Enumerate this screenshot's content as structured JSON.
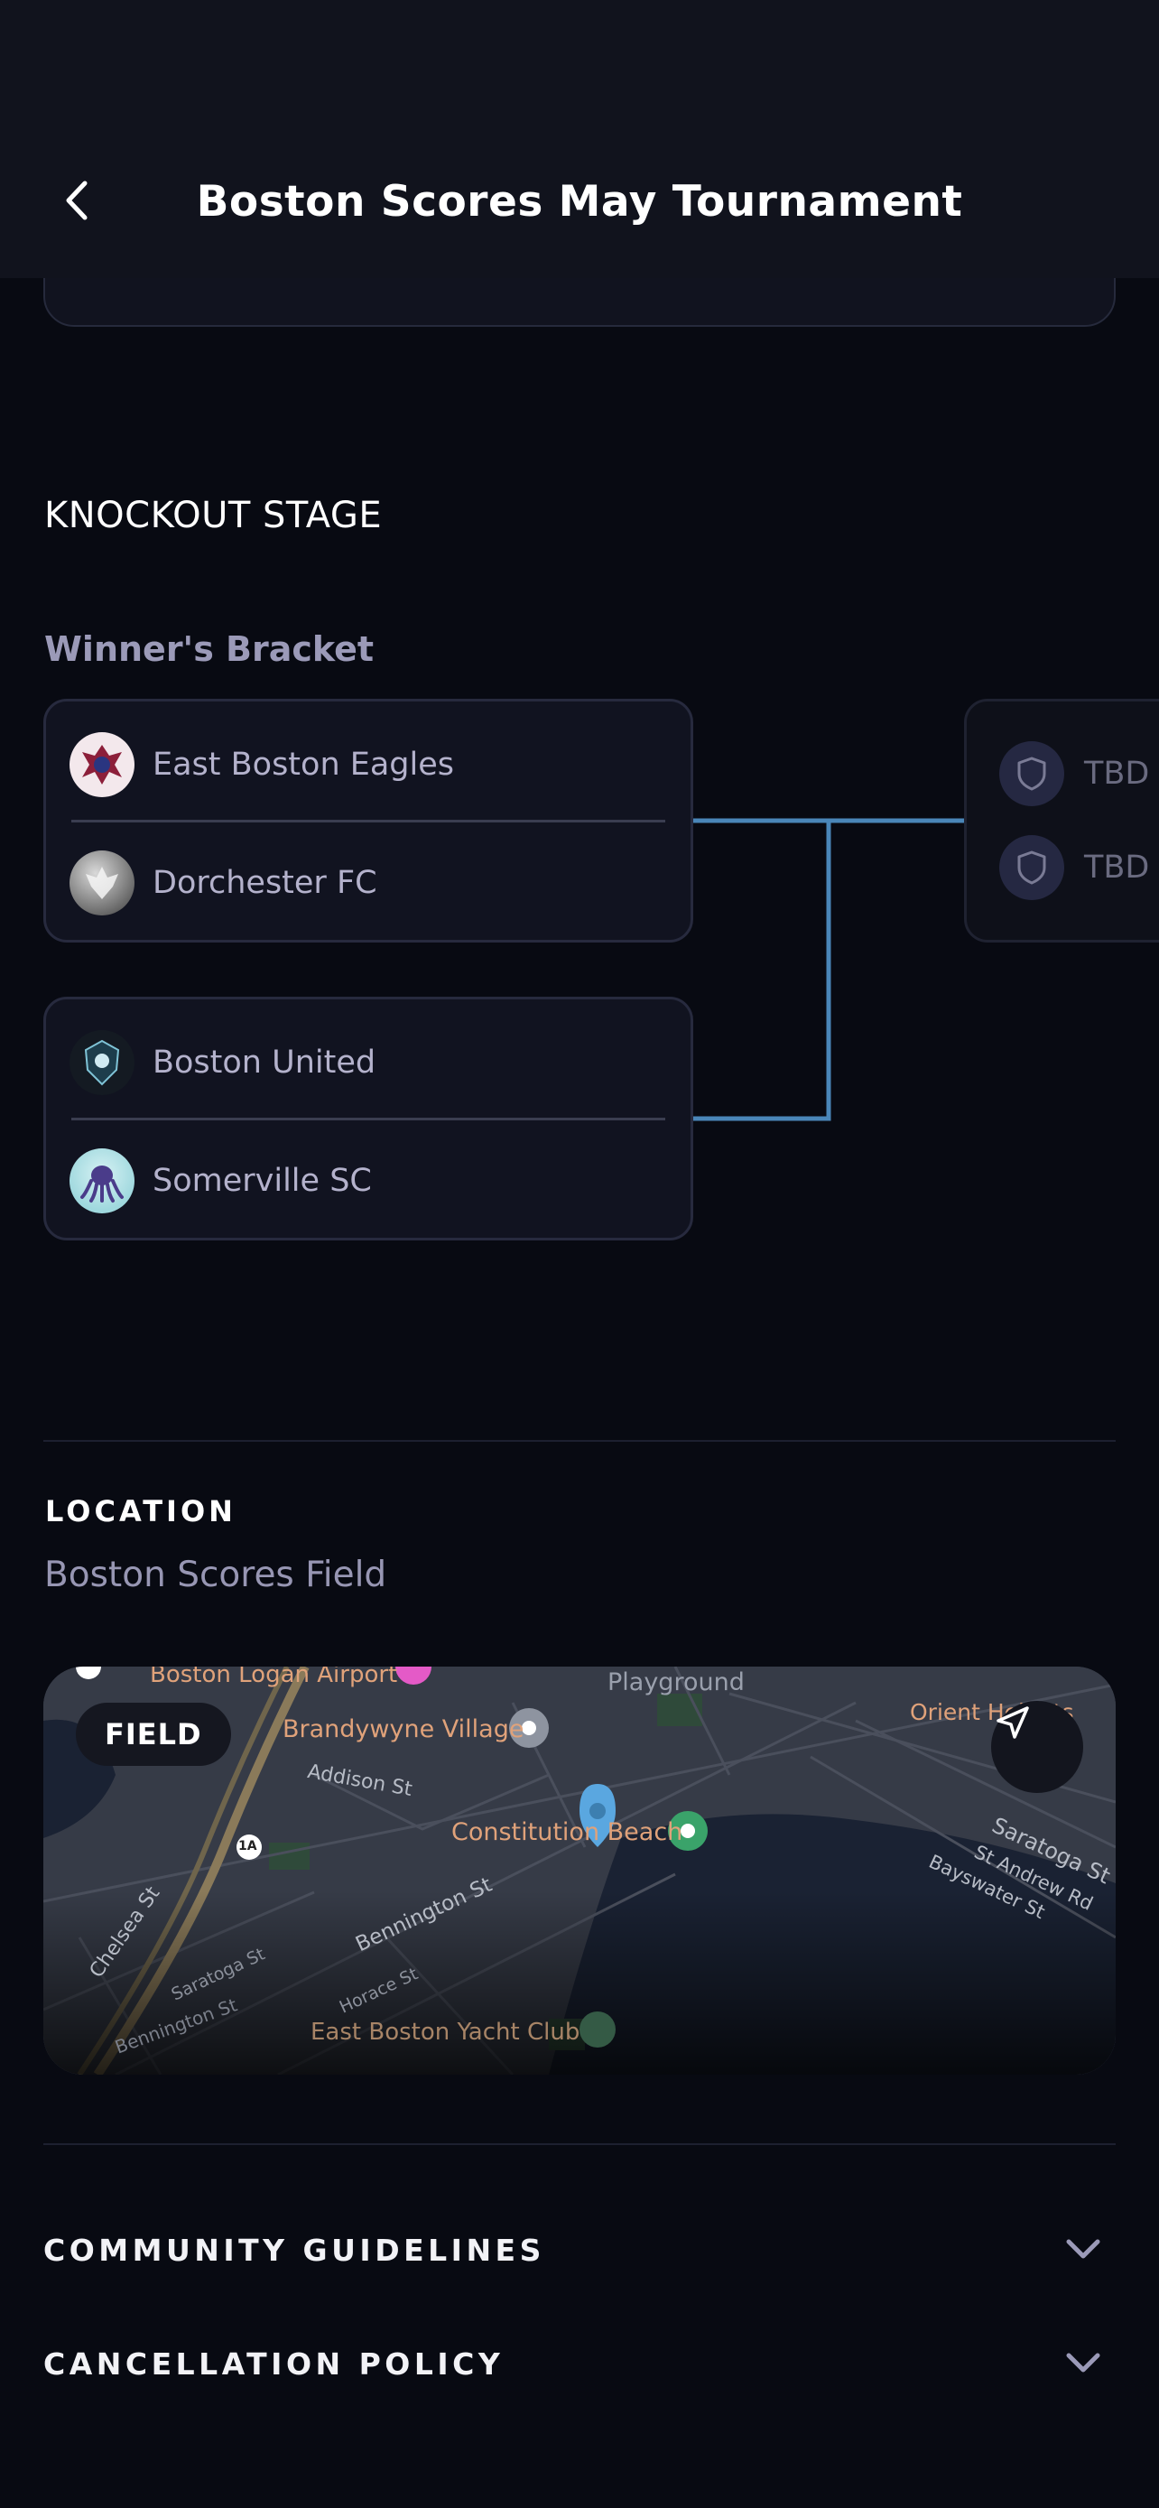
{
  "header": {
    "title": "Boston Scores May Tournament"
  },
  "knockout": {
    "section_title": "KNOCKOUT STAGE",
    "bracket_title": "Winner's Bracket",
    "matches": [
      {
        "team1": "East Boston Eagles",
        "team2": "Dorchester FC"
      },
      {
        "team1": "Boston United",
        "team2": "Somerville SC"
      }
    ],
    "next_round": {
      "team1": "TBD",
      "team2": "TBD"
    }
  },
  "location": {
    "label": "LOCATION",
    "value": "Boston Scores Field",
    "map": {
      "badge": "FIELD",
      "labels": {
        "airport": "Boston Logan Airport",
        "playground": "Playground",
        "brandywyne": "Brandywyne Village",
        "orient": "Orient Heights",
        "addison": "Addison St",
        "constitution": "Constitution Beach",
        "saratoga_e": "Saratoga St",
        "st_andrew": "St Andrew Rd",
        "bayswater": "Bayswater St",
        "chelsea": "Chelsea St",
        "bennington": "Bennington St",
        "saratoga_w": "Saratoga St",
        "horace": "Horace St",
        "bennington_low": "Bennington St",
        "yacht": "East Boston Yacht Club",
        "route": "1A"
      }
    }
  },
  "accordions": [
    {
      "label": "COMMUNITY GUIDELINES"
    },
    {
      "label": "CANCELLATION POLICY"
    }
  ]
}
